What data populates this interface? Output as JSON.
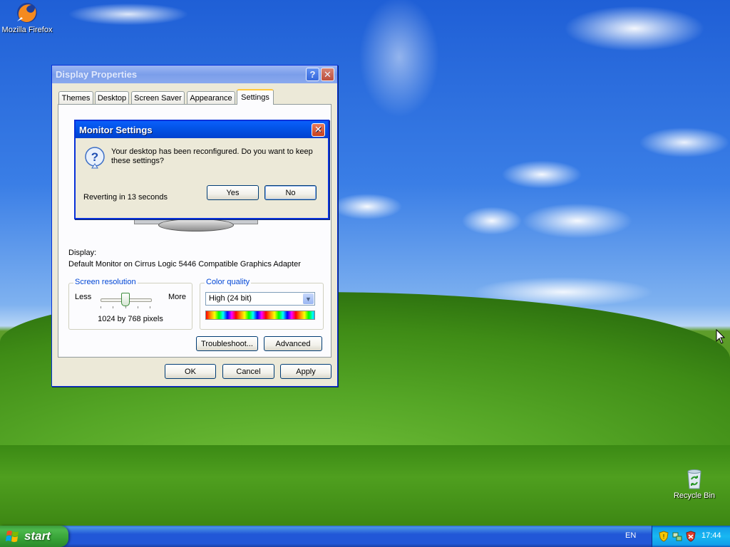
{
  "desktop": {
    "icons": [
      {
        "label": "Mozilla Firefox",
        "icon": "firefox-icon"
      },
      {
        "label": "Recycle Bin",
        "icon": "recycle-bin-icon"
      }
    ]
  },
  "display_properties": {
    "title": "Display Properties",
    "tabs": [
      "Themes",
      "Desktop",
      "Screen Saver",
      "Appearance",
      "Settings"
    ],
    "selected_tab": "Settings",
    "display_label": "Display:",
    "display_value": "Default Monitor on Cirrus Logic 5446 Compatible Graphics Adapter",
    "resolution": {
      "group_label": "Screen resolution",
      "less": "Less",
      "more": "More",
      "value_text": "1024 by 768 pixels"
    },
    "color_quality": {
      "group_label": "Color quality",
      "selected": "High (24 bit)"
    },
    "buttons": {
      "troubleshoot": "Troubleshoot...",
      "advanced": "Advanced",
      "ok": "OK",
      "cancel": "Cancel",
      "apply": "Apply"
    }
  },
  "monitor_settings": {
    "title": "Monitor Settings",
    "message": "Your desktop has been reconfigured.  Do you want to keep these settings?",
    "countdown": "Reverting in 13 seconds",
    "yes": "Yes",
    "no": "No"
  },
  "taskbar": {
    "start_label": "start",
    "language": "EN",
    "clock": "17:44"
  },
  "colors": {
    "title_active": "#0354e8",
    "title_inactive": "#7b9eea",
    "window_face": "#ece9d8",
    "taskbar": "#2157d7",
    "start_green": "#37a337"
  }
}
